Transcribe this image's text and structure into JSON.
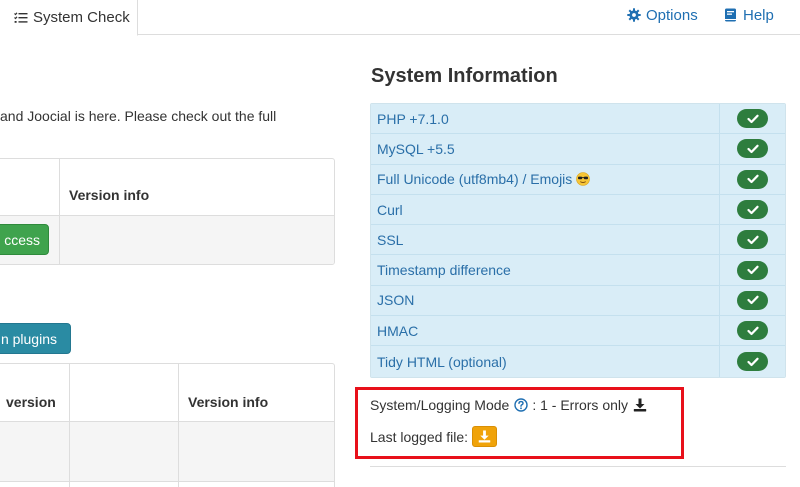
{
  "tabs": {
    "system_check": "System Check"
  },
  "header_links": {
    "options": "Options",
    "help": "Help"
  },
  "intro_text": "and Joocial is here. Please check out the full",
  "table1": {
    "header_version": "Version info",
    "button_label": "ccess"
  },
  "plugins_button_label": "n plugins",
  "table2": {
    "header_col1": "version",
    "header_version": "Version info"
  },
  "system_information": {
    "title": "System Information",
    "items": [
      {
        "label": "PHP +7.1.0",
        "status": "ok"
      },
      {
        "label": "MySQL +5.5",
        "status": "ok"
      },
      {
        "label": "Full Unicode (utf8mb4) / Emojis",
        "status": "ok"
      },
      {
        "label": "Curl",
        "status": "ok"
      },
      {
        "label": "SSL",
        "status": "ok"
      },
      {
        "label": "Timestamp difference",
        "status": "ok"
      },
      {
        "label": "JSON",
        "status": "ok"
      },
      {
        "label": "HMAC",
        "status": "ok"
      },
      {
        "label": "Tidy HTML (optional)",
        "status": "ok"
      }
    ]
  },
  "logging": {
    "mode_label": "System/Logging Mode",
    "mode_value": ": 1 - Errors only",
    "last_file_label": "Last logged file:"
  },
  "colors": {
    "link": "#1f6fb2",
    "info_bg": "#d9edf7",
    "ok_badge": "#2e7d3e",
    "highlight": "#e8101a",
    "orange_button": "#f0a30a",
    "green_button": "#3fa34d",
    "teal_button": "#2a8ba3"
  }
}
